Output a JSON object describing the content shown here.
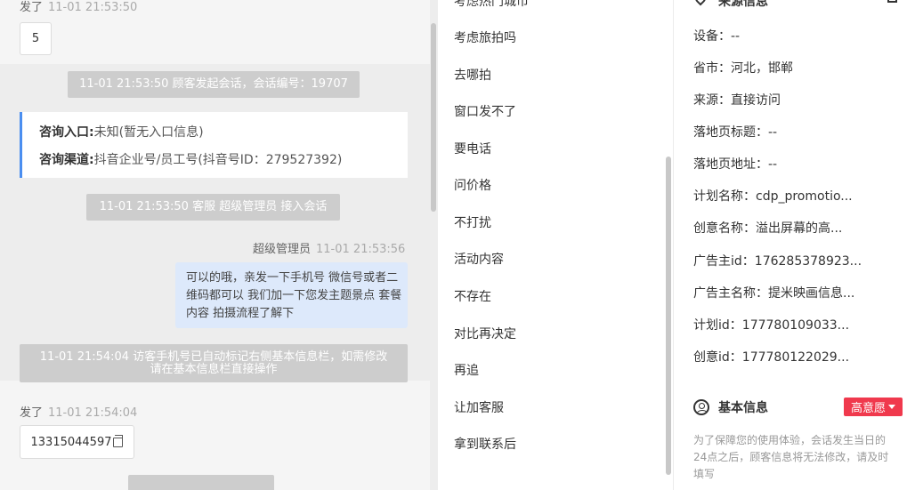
{
  "chat": {
    "msg1": {
      "sender": "发了",
      "time": "11-01 21:53:50",
      "content": "5"
    },
    "notice_session": "11-01 21:53:50 顾客发起会话，会话编号：19707",
    "entry_card": {
      "entry_label": "咨询入口:",
      "entry_value": "未知(暂无入口信息)",
      "channel_label": "咨询渠道:",
      "channel_value": "抖音企业号/员工号(抖音号ID：279527392)"
    },
    "notice_agent": "11-01 21:53:50 客服 超级管理员 接入会话",
    "agent_msg": {
      "sender": "超级管理员",
      "time": "11-01 21:53:56",
      "content": "可以的哦，亲发一下手机号 微信号或者二维码都可以 我们加一下您发主题景点 套餐内容 拍摄流程了解下"
    },
    "notice_phone_line1": "11-01 21:54:04 访客手机号已自动标记右侧基本信息栏，如需修改",
    "notice_phone_line2": "请在基本信息栏直接操作",
    "msg2": {
      "sender": "发了",
      "time": "11-01 21:54:04",
      "content": "13315044597"
    }
  },
  "quick_replies": {
    "cut_top": "考虑热门城市",
    "items": [
      "考虑旅拍吗",
      "去哪拍",
      "窗口发不了",
      "要电话",
      "问价格",
      "不打扰",
      "活动内容",
      "不存在",
      "对比再决定",
      "再追",
      "让加客服",
      "拿到联系后"
    ]
  },
  "info": {
    "source_title": "来源信息",
    "rows": [
      {
        "label": "设备：",
        "value": "--"
      },
      {
        "label": "省市：",
        "value": "河北，邯郸"
      },
      {
        "label": "来源：",
        "value": "直接访问"
      },
      {
        "label": "落地页标题：",
        "value": "--"
      },
      {
        "label": "落地页地址：",
        "value": "--"
      },
      {
        "label": "计划名称：",
        "value": "cdp_promotio..."
      },
      {
        "label": "创意名称：",
        "value": "溢出屏幕的高..."
      },
      {
        "label": "广告主id：",
        "value": "176285378923..."
      },
      {
        "label": "广告主名称：",
        "value": "提米映画信息..."
      },
      {
        "label": "计划id：",
        "value": "177780109033..."
      },
      {
        "label": "创意id：",
        "value": "177780122029..."
      }
    ],
    "basic_title": "基本信息",
    "intent_badge": "高意愿",
    "notice": "为了保障您的使用体验，会话发生当日的24点之后，顾客信息将无法修改，请及时填写",
    "colors": {
      "badge": "#f0394d",
      "accent": "#4a8ef0",
      "agent_bubble": "#dde9fb"
    }
  }
}
